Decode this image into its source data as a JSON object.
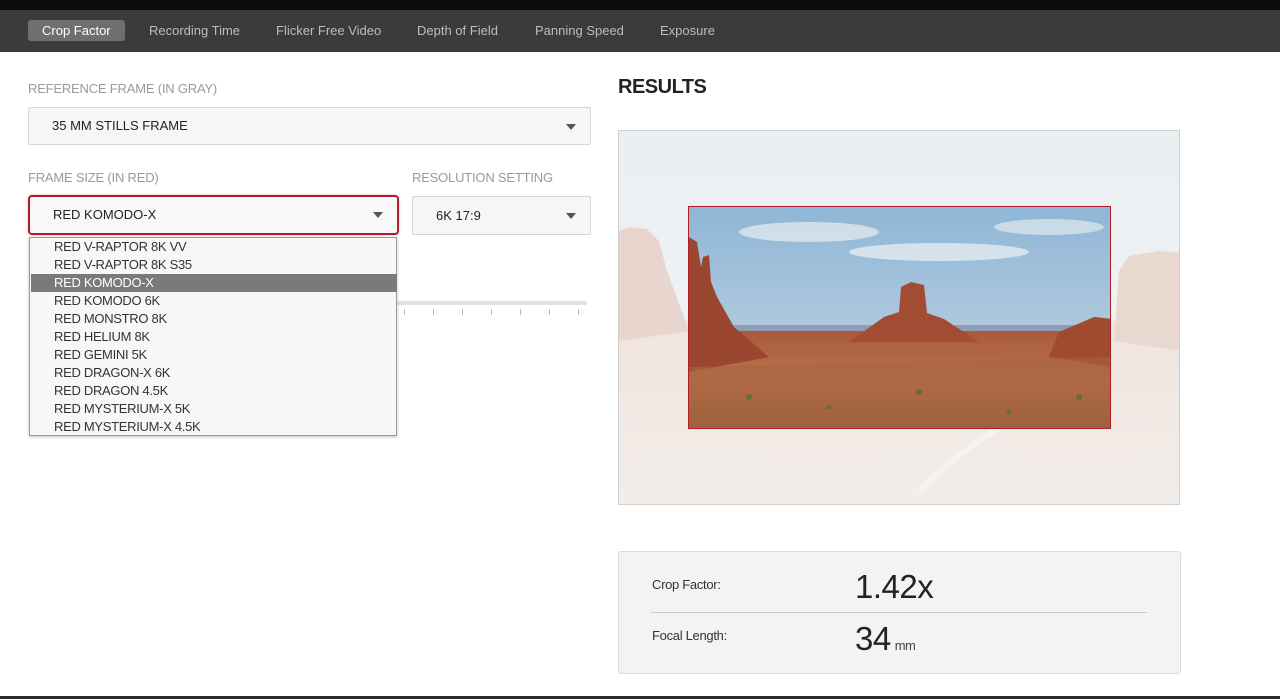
{
  "nav": {
    "tabs": [
      {
        "label": "Crop Factor",
        "active": true
      },
      {
        "label": "Recording Time",
        "active": false
      },
      {
        "label": "Flicker Free Video",
        "active": false
      },
      {
        "label": "Depth of Field",
        "active": false
      },
      {
        "label": "Panning Speed",
        "active": false
      },
      {
        "label": "Exposure",
        "active": false
      }
    ]
  },
  "form": {
    "reference_label": "REFERENCE FRAME (IN GRAY)",
    "reference_value": "35 MM STILLS FRAME",
    "frame_size_label": "FRAME SIZE (IN RED)",
    "frame_size_value": "RED KOMODO-X",
    "resolution_label": "RESOLUTION SETTING",
    "resolution_value": "6K 17:9",
    "frame_size_options": [
      "RED V-RAPTOR 8K VV",
      "RED V-RAPTOR 8K S35",
      "RED KOMODO-X",
      "RED KOMODO 6K",
      "RED MONSTRO 8K",
      "RED HELIUM 8K",
      "RED GEMINI 5K",
      "RED DRAGON-X 6K",
      "RED DRAGON 4.5K",
      "RED MYSTERIUM-X 5K",
      "RED MYSTERIUM-X 4.5K"
    ],
    "selected_option_index": 2
  },
  "results": {
    "title": "RESULTS",
    "crop_factor_label": "Crop Factor:",
    "crop_factor_value": "1.42x",
    "focal_length_label": "Focal Length:",
    "focal_length_value": "34",
    "focal_length_unit": "mm"
  },
  "colors": {
    "accent_red": "#b01e2a",
    "navbar_bg": "#3b3b3b",
    "active_tab_bg": "#6f6f6f"
  },
  "icons": {
    "dropdown_caret": "chevron-down-icon"
  }
}
